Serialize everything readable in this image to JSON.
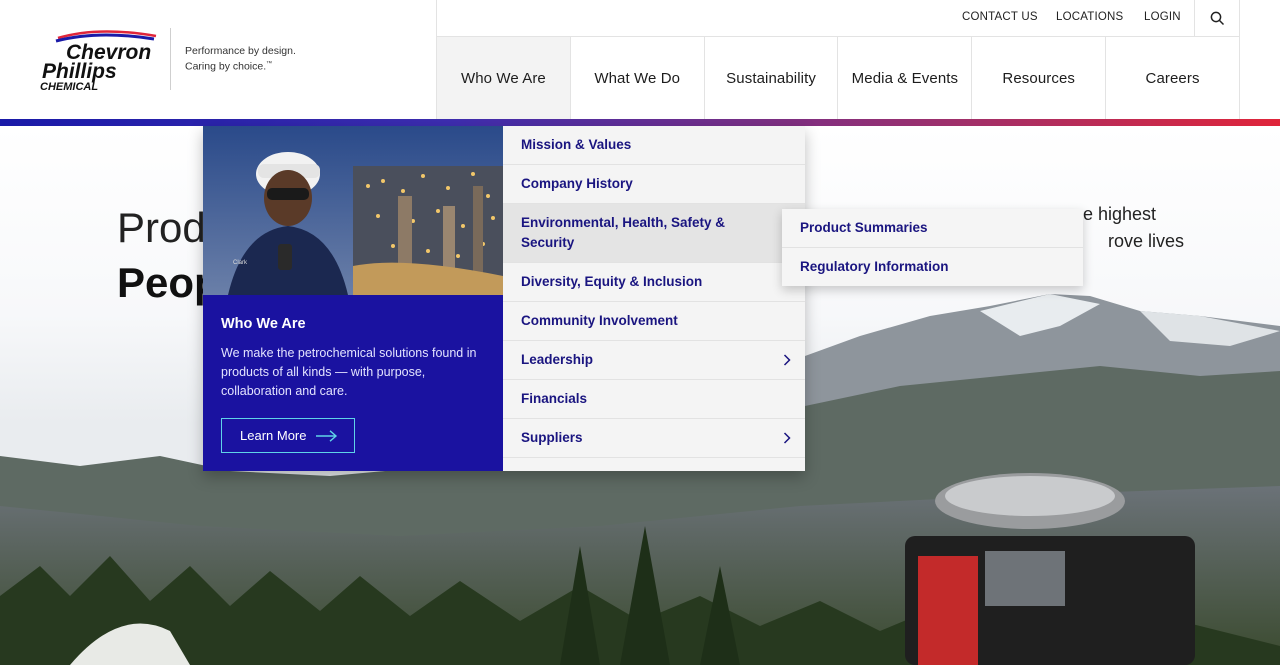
{
  "brand": {
    "logo_line1": "Chevron",
    "logo_line2": "Phillips",
    "logo_line3": "CHEMICAL",
    "tagline_line1": "Performance by design.",
    "tagline_line2": "Caring by choice.",
    "tagline_mark": "™"
  },
  "utility_nav": {
    "contact": "CONTACT US",
    "locations": "LOCATIONS",
    "login": "LOGIN",
    "search_icon": "search-icon"
  },
  "main_nav": [
    {
      "label": "Who We Are",
      "active": true
    },
    {
      "label": "What We Do",
      "active": false
    },
    {
      "label": "Sustainability",
      "active": false
    },
    {
      "label": "Media & Events",
      "active": false
    },
    {
      "label": "Resources",
      "active": false
    },
    {
      "label": "Careers",
      "active": false
    }
  ],
  "hero": {
    "headline_line1": "Prod",
    "headline_line2": "Peop",
    "right_line1": "e highest",
    "right_line2": "rove lives"
  },
  "mega_menu": {
    "feature": {
      "title": "Who We Are",
      "description": "We make the petrochemical solutions found in products of all kinds — with purpose, collaboration and care.",
      "button_label": "Learn More",
      "badge_text": "Clark"
    },
    "items": [
      {
        "label": "Mission & Values",
        "has_children": false
      },
      {
        "label": "Company History",
        "has_children": false
      },
      {
        "label": "Environmental, Health, Safety & Security",
        "has_children": true
      },
      {
        "label": "Diversity, Equity & Inclusion",
        "has_children": false
      },
      {
        "label": "Community Involvement",
        "has_children": false
      },
      {
        "label": "Leadership",
        "has_children": true
      },
      {
        "label": "Financials",
        "has_children": false
      },
      {
        "label": "Suppliers",
        "has_children": true
      }
    ],
    "submenu": [
      {
        "label": "Product Summaries"
      },
      {
        "label": "Regulatory Information"
      }
    ]
  },
  "colors": {
    "menu_text": "#1a1580",
    "feature_bg": "#1a12a0",
    "button_border": "#5fd3e8",
    "gradient_start": "#1a1aa8",
    "gradient_end": "#e0253a"
  }
}
